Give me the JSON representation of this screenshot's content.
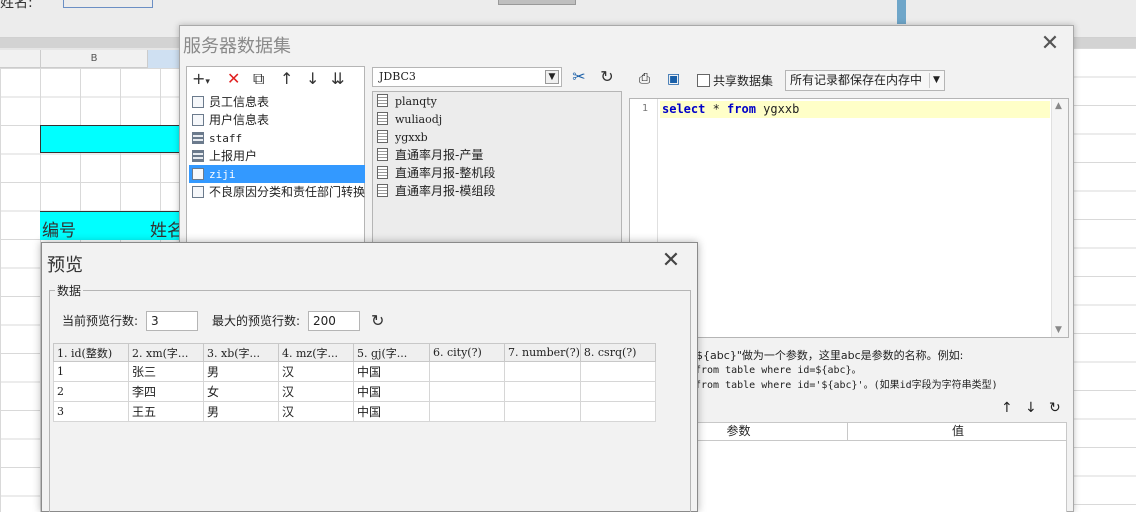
{
  "sheet": {
    "cell_label": "姓名:",
    "col_b": "B",
    "header_row": [
      "编号",
      "姓名"
    ]
  },
  "server_dataset": {
    "title": "服务器数据集",
    "toolbar": {
      "add": "+",
      "add_caret": "▾",
      "delete": "✕",
      "copy": "⧉",
      "up": "↑",
      "down": "↓",
      "sort": "⇊"
    },
    "tree": [
      {
        "label": "员工信息表",
        "icon": "file-dataset-icon"
      },
      {
        "label": "用户信息表",
        "icon": "file-dataset-icon"
      },
      {
        "label": "staff",
        "icon": "db-dataset-icon"
      },
      {
        "label": "上报用户",
        "icon": "db-dataset-icon"
      },
      {
        "label": "ziji",
        "icon": "file-dataset-icon",
        "selected": true
      },
      {
        "label": "不良原因分类和责任部门转换",
        "icon": "file-dataset-icon"
      }
    ],
    "connection": "JDBC3",
    "tables": [
      "planqty",
      "wuliaodj",
      "ygxxb",
      "直通率月报-产量",
      "直通率月报-整机段",
      "直通率月报-模组段"
    ],
    "share_label": "共享数据集",
    "memory_option": "所有记录都保存在内存中",
    "sql": {
      "line_no": "1",
      "kw1": "select",
      "mid": " * ",
      "kw2": "from",
      "rest": " ygxxb"
    },
    "hint": [
      "\"${abc}\"做为一个参数，这里abc是参数的名称。例如:",
      "from table where id=${abc}。",
      "from table where id='${abc}'。(如果id字段为字符串类型)"
    ],
    "param_headers": [
      "参数",
      "值"
    ]
  },
  "preview": {
    "title": "预览",
    "group_label": "数据",
    "current_rows_label": "当前预览行数:",
    "current_rows": "3",
    "max_rows_label": "最大的预览行数:",
    "max_rows": "200",
    "columns": [
      "1. id(整数)",
      "2. xm(字...",
      "3. xb(字...",
      "4. mz(字...",
      "5. gj(字...",
      "6. city(?)",
      "7. number(?)",
      "8. csrq(?)"
    ],
    "rows": [
      [
        "1",
        "张三",
        "男",
        "汉",
        "中国",
        "",
        "",
        ""
      ],
      [
        "2",
        "李四",
        "女",
        "汉",
        "中国",
        "",
        "",
        ""
      ],
      [
        "3",
        "王五",
        "男",
        "汉",
        "中国",
        "",
        "",
        ""
      ]
    ]
  }
}
